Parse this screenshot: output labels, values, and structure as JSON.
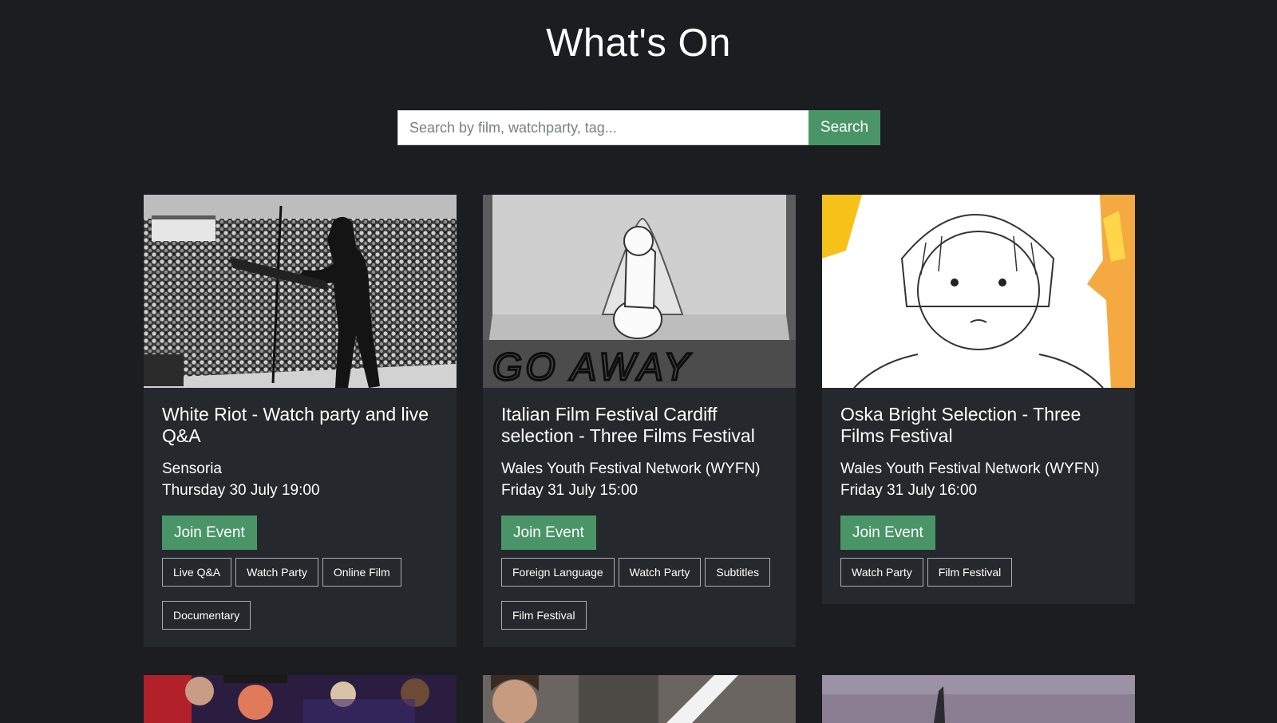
{
  "page": {
    "title": "What's On"
  },
  "search": {
    "placeholder": "Search by film, watchparty, tag...",
    "button_label": "Search"
  },
  "events": [
    {
      "title": "White Riot - Watch party and live Q&A",
      "host": "Sensoria",
      "datetime": "Thursday 30 July 19:00",
      "join_label": "Join Event",
      "tags": [
        "Live Q&A",
        "Watch Party",
        "Online Film",
        "Documentary"
      ]
    },
    {
      "title": "Italian Film Festival Cardiff selection - Three Films Festival",
      "host": "Wales Youth Festival Network (WYFN)",
      "datetime": "Friday 31 July 15:00",
      "join_label": "Join Event",
      "image_text": "GO AWAY",
      "tags": [
        "Foreign Language",
        "Watch Party",
        "Subtitles",
        "Film Festival"
      ]
    },
    {
      "title": "Oska Bright Selection - Three Films Festival",
      "host": "Wales Youth Festival Network (WYFN)",
      "datetime": "Friday 31 July 16:00",
      "join_label": "Join Event",
      "tags": [
        "Watch Party",
        "Film Festival"
      ]
    }
  ],
  "colors": {
    "background": "#1b1d20",
    "card": "#25282c",
    "accent": "#4a9567",
    "tag_border": "#a8adb8"
  }
}
